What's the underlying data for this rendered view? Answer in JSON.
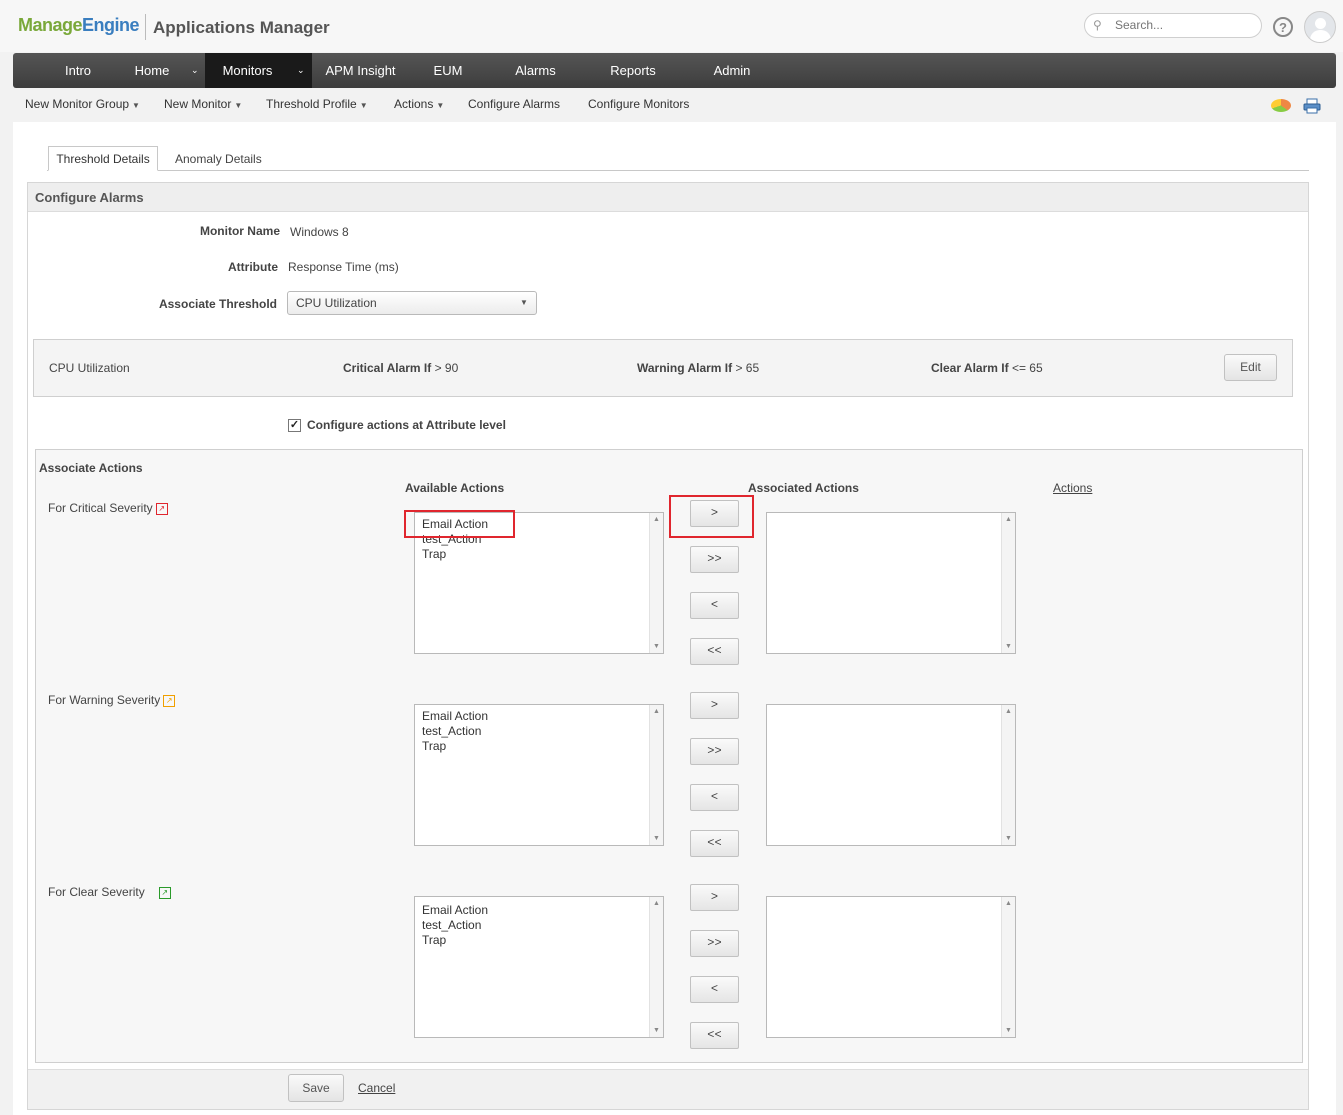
{
  "header": {
    "logo_part1": "Manage",
    "logo_part2": "Engine",
    "app_title": "Applications Manager",
    "search_placeholder": "Search...",
    "help_symbol": "?"
  },
  "nav": {
    "items": [
      {
        "label": "Intro"
      },
      {
        "label": "Home"
      },
      {
        "label": "Monitors"
      },
      {
        "label": "APM Insight"
      },
      {
        "label": "EUM"
      },
      {
        "label": "Alarms"
      },
      {
        "label": "Reports"
      },
      {
        "label": "Admin"
      }
    ],
    "active": "Monitors"
  },
  "submenu": {
    "items": [
      {
        "label": "New Monitor Group",
        "has_dropdown": true
      },
      {
        "label": "New Monitor",
        "has_dropdown": true
      },
      {
        "label": "Threshold Profile",
        "has_dropdown": true
      },
      {
        "label": "Actions",
        "has_dropdown": true
      },
      {
        "label": "Configure Alarms",
        "has_dropdown": false
      },
      {
        "label": "Configure Monitors",
        "has_dropdown": false
      }
    ]
  },
  "tabs": [
    {
      "label": "Threshold Details",
      "active": true
    },
    {
      "label": "Anomaly Details",
      "active": false
    }
  ],
  "panel": {
    "title": "Configure Alarms",
    "monitor_name_label": "Monitor Name",
    "monitor_name_value": "Windows 8",
    "attribute_label": "Attribute",
    "attribute_value": "Response Time (ms)",
    "associate_threshold_label": "Associate Threshold",
    "associate_threshold_value": "CPU Utilization"
  },
  "threshold": {
    "name": "CPU Utilization",
    "critical_label": "Critical Alarm If",
    "critical_cond": "> 90",
    "warning_label": "Warning Alarm If",
    "warning_cond": "> 65",
    "clear_label": "Clear Alarm If",
    "clear_cond": "<= 65",
    "edit_label": "Edit"
  },
  "configure_actions": {
    "label": "Configure actions at Attribute level",
    "checked": true
  },
  "associate_actions": {
    "title": "Associate Actions",
    "available_header": "Available Actions",
    "associated_header": "Associated Actions",
    "actions_link": "Actions",
    "severities": [
      {
        "label": "For Critical Severity",
        "available": [
          "Email Action",
          "test_Action",
          "Trap"
        ],
        "associated": []
      },
      {
        "label": "For Warning Severity",
        "available": [
          "Email Action",
          "test_Action",
          "Trap"
        ],
        "associated": []
      },
      {
        "label": "For Clear Severity",
        "available": [
          "Email Action",
          "test_Action",
          "Trap"
        ],
        "associated": []
      }
    ],
    "move_buttons": [
      ">",
      ">>",
      "<",
      "<<"
    ]
  },
  "footer": {
    "save_label": "Save",
    "cancel_label": "Cancel"
  },
  "colors": {
    "nav_bg": "#464646",
    "nav_active": "#1a1a1a",
    "highlight": "#e0262e",
    "critical": "#e0262e",
    "warning": "#f0a000",
    "clear": "#2a9a2a"
  }
}
